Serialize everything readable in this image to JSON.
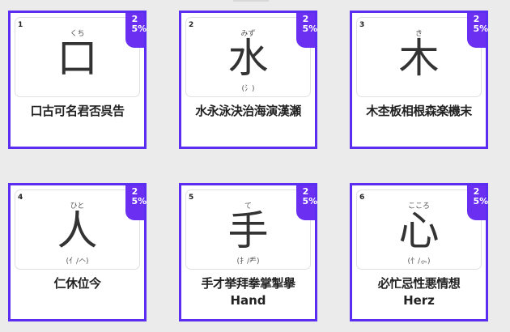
{
  "cards": [
    {
      "number": "1",
      "reading": "くち",
      "kanji": "口",
      "radical": "",
      "list": "口古可名君否呉告",
      "english": "",
      "progress": "25%"
    },
    {
      "number": "2",
      "reading": "みず",
      "kanji": "水",
      "radical": "(氵)",
      "list": "水永泳決治海演漢瀬",
      "english": "",
      "progress": "25%"
    },
    {
      "number": "3",
      "reading": "き",
      "kanji": "木",
      "radical": "",
      "list": "木杢板相根森楽機末",
      "english": "",
      "progress": "25%"
    },
    {
      "number": "4",
      "reading": "ひと",
      "kanji": "人",
      "radical": "(亻/𠆢)",
      "list": "仁休位今",
      "english": "",
      "progress": "25%"
    },
    {
      "number": "5",
      "reading": "て",
      "kanji": "手",
      "radical": "(扌/龵)",
      "list": "手才挙拜拳掌掣擧",
      "english": "Hand",
      "progress": "25%"
    },
    {
      "number": "6",
      "reading": "こころ",
      "kanji": "心",
      "radical": "(忄/⺗)",
      "list": "必忙忌性悪情想",
      "english": "Herz",
      "progress": "25%"
    }
  ],
  "colors": {
    "accent": "#5a2df0",
    "badge": "#6a2ff0"
  }
}
